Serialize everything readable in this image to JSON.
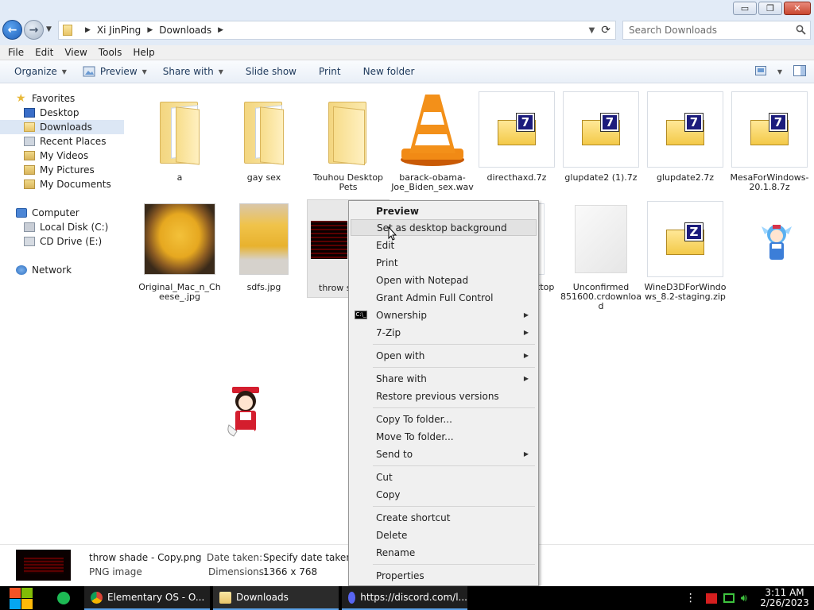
{
  "window": {
    "minimize": "▭",
    "maximize": "❐",
    "close": "✕"
  },
  "address": {
    "path": [
      "Xi JinPing",
      "Downloads"
    ],
    "dropdown": "▼",
    "refresh": "⟳"
  },
  "search": {
    "placeholder": "Search Downloads"
  },
  "menubar": [
    "File",
    "Edit",
    "View",
    "Tools",
    "Help"
  ],
  "toolbar": {
    "organize": "Organize",
    "preview": "Preview",
    "share": "Share with",
    "slideshow": "Slide show",
    "print": "Print",
    "newfolder": "New folder"
  },
  "sidebar": {
    "favorites": {
      "label": "Favorites",
      "items": [
        "Desktop",
        "Downloads",
        "Recent Places",
        "My Videos",
        "My Pictures",
        "My Documents"
      ]
    },
    "computer": {
      "label": "Computer",
      "items": [
        "Local Disk (C:)",
        "CD Drive (E:)"
      ]
    },
    "network": "Network"
  },
  "files": [
    {
      "name": "a",
      "kind": "folder"
    },
    {
      "name": "gay sex",
      "kind": "folder"
    },
    {
      "name": "Touhou Desktop Pets",
      "kind": "folder"
    },
    {
      "name": "barack-obama-Joe_Biden_sex.wav",
      "kind": "vlc"
    },
    {
      "name": "directhaxd.7z",
      "kind": "7z"
    },
    {
      "name": "glupdate2 (1).7z",
      "kind": "7z"
    },
    {
      "name": "glupdate2.7z",
      "kind": "7z"
    },
    {
      "name": "MesaForWindows-20.1.8.7z",
      "kind": "7z"
    },
    {
      "name": "Original_Mac_n_Cheese_.jpg",
      "kind": "image"
    },
    {
      "name": "sdfs.jpg",
      "kind": "image"
    },
    {
      "name": "throw shade - Copy",
      "kind": "image-selected"
    },
    {
      "name": "ttop",
      "kind": "partial"
    },
    {
      "name": "Unconfirmed 851600.crdownload",
      "kind": "blank"
    },
    {
      "name": "WineD3DForWindows_8.2-staging.zip",
      "kind": "zip"
    }
  ],
  "file_labels": {
    "f0": "a",
    "f1": "gay sex",
    "f2": "Touhou Desktop Pets",
    "f3": "barack-obama-Joe_Biden_sex.wav",
    "f4": "directhaxd.7z",
    "f5": "glupdate2 (1).7z",
    "f6": "glupdate2.7z",
    "f7": "MesaForWindows-20.1.8.7z",
    "f8": "Original_Mac_n_Cheese_.jpg",
    "f9": "sdfs.jpg",
    "f10": "throw s Copy",
    "f11": "ttop",
    "f12": "Unconfirmed 851600.crdownload",
    "f13": "WineD3DForWindows_8.2-staging.zip"
  },
  "context_menu": {
    "preview": "Preview",
    "set_bg": "Set as desktop background",
    "edit": "Edit",
    "print": "Print",
    "notepad": "Open with Notepad",
    "grant": "Grant Admin Full Control",
    "ownership": "Ownership",
    "zip": "7-Zip",
    "open_with": "Open with",
    "share_with": "Share with",
    "restore": "Restore previous versions",
    "copy_to": "Copy To folder...",
    "move_to": "Move To folder...",
    "send_to": "Send to",
    "cut": "Cut",
    "copy": "Copy",
    "shortcut": "Create shortcut",
    "delete": "Delete",
    "rename": "Rename",
    "properties": "Properties",
    "cmd_icon_text": "C:\\_"
  },
  "details": {
    "filename": "throw shade - Copy.png",
    "type": "PNG image",
    "date_label": "Date taken:",
    "date_value": "Specify date taken",
    "dim_label": "Dimensions:",
    "dim_value": "1366 x 768"
  },
  "taskbar": {
    "tasks": [
      "Elementary OS - O...",
      "Downloads",
      "https://discord.com/l..."
    ],
    "time": "3:11 AM",
    "date": "2/26/2023"
  },
  "colors": {
    "accent": "#5aa0e6",
    "selection": "#dce7f5",
    "taskbar": "#000000"
  }
}
